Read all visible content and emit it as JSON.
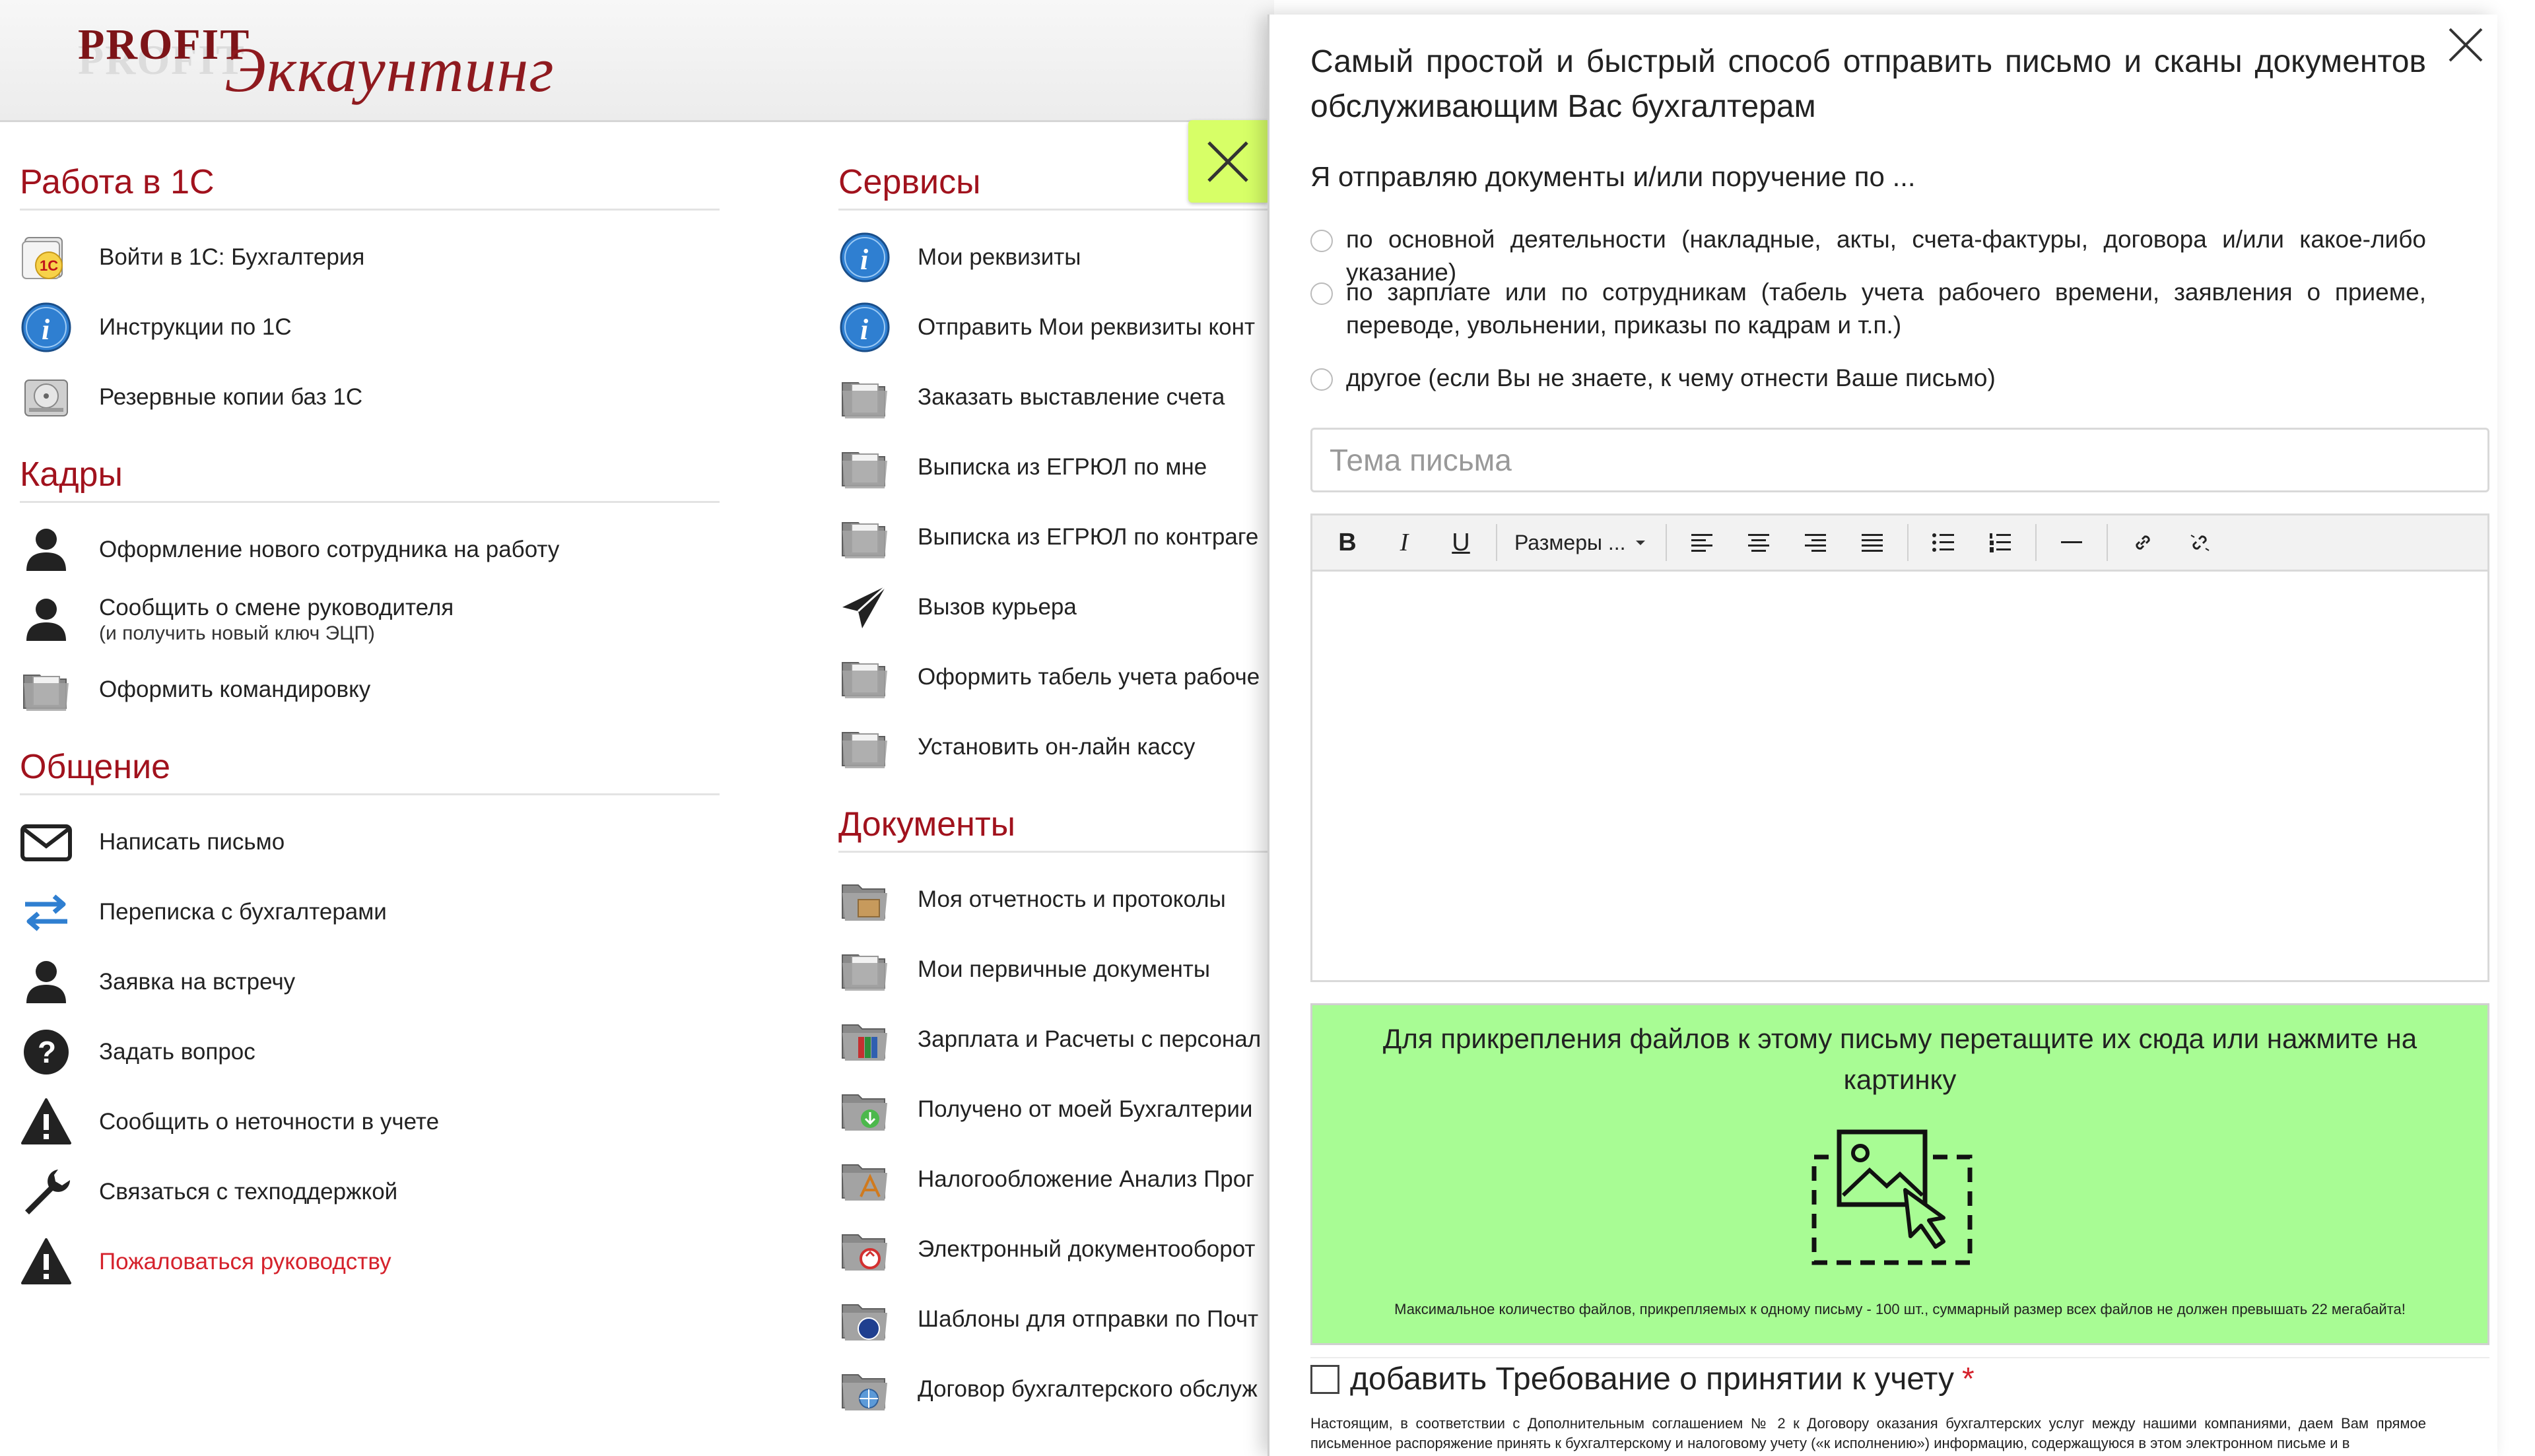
{
  "logo": {
    "brand": "PROFIT",
    "script": "Эккаунтинг"
  },
  "left_sections": [
    {
      "title": "Работа в 1С",
      "items": [
        {
          "label": "Войти в 1С: Бухгалтерия",
          "icon": "1c-icon"
        },
        {
          "label": "Инструкции по 1С",
          "icon": "info-icon"
        },
        {
          "label": "Резервные копии баз 1С",
          "icon": "hard-drive-icon"
        }
      ]
    },
    {
      "title": "Кадры",
      "items": [
        {
          "label": "Оформление нового сотрудника на работу",
          "icon": "person-icon"
        },
        {
          "label": "Сообщить о смене руководителя",
          "sub": "(и получить новый ключ ЭЦП)",
          "icon": "person-icon"
        },
        {
          "label": "Оформить командировку",
          "icon": "folder-icon"
        }
      ]
    },
    {
      "title": "Общение",
      "items": [
        {
          "label": "Написать письмо",
          "icon": "envelope-icon"
        },
        {
          "label": "Переписка с бухгалтерами",
          "icon": "exchange-arrows-icon"
        },
        {
          "label": "Заявка на встречу",
          "icon": "person-icon"
        },
        {
          "label": "Задать вопрос",
          "icon": "question-icon"
        },
        {
          "label": "Сообщить о неточности в учете",
          "icon": "warning-icon"
        },
        {
          "label": "Связаться с техподдержкой",
          "icon": "wrench-icon"
        },
        {
          "label": "Пожаловаться руководству",
          "icon": "warning-icon"
        }
      ]
    }
  ],
  "mid_sections": [
    {
      "title": "Сервисы",
      "items": [
        {
          "label": "Мои реквизиты",
          "icon": "info-icon"
        },
        {
          "label": "Отправить Мои реквизиты конт",
          "icon": "info-icon"
        },
        {
          "label": "Заказать выставление счета",
          "icon": "folder-icon"
        },
        {
          "label": "Выписка из ЕГРЮЛ по мне",
          "icon": "folder-icon"
        },
        {
          "label": "Выписка из ЕГРЮЛ по контраге",
          "icon": "folder-icon"
        },
        {
          "label": "Вызов курьера",
          "icon": "paper-plane-icon"
        },
        {
          "label": "Оформить табель учета рабоче",
          "icon": "folder-icon"
        },
        {
          "label": "Установить он-лайн кассу",
          "icon": "folder-icon"
        }
      ]
    },
    {
      "title": "Документы",
      "items": [
        {
          "label": "Моя отчетность и протоколы",
          "icon": "folder-box-icon"
        },
        {
          "label": "Мои первичные документы",
          "icon": "folder-icon"
        },
        {
          "label": "Зарплата и Расчеты с персонал",
          "icon": "folder-books-icon"
        },
        {
          "label": "Получено от моей Бухгалтерии",
          "icon": "folder-download-icon"
        },
        {
          "label": "Налогообложение Анализ Прог",
          "icon": "folder-app-icon"
        },
        {
          "label": "Электронный документооборот",
          "icon": "folder-sync-icon"
        },
        {
          "label": "Шаблоны для отправки по Почт",
          "icon": "folder-post-icon"
        },
        {
          "label": "Договор бухгалтерского обслуж",
          "icon": "folder-globe-icon"
        }
      ]
    }
  ],
  "panel": {
    "title": "Самый простой и быстрый способ отправить письмо и сканы документов обслуживающим Вас бухгалтерам",
    "subtitle": "Я отправляю документы и/или поручение по ...",
    "options": [
      "по основной деятельности (накладные, акты, счета-фактуры, договора и/или какое-либо указание)",
      "по зарплате или по сотрудникам (табель учета рабочего времени, заявления о приеме, переводе, увольнении, приказы по кадрам и т.п.)",
      "другое (если Вы не знаете, к чему отнести Ваше письмо)"
    ],
    "subject_placeholder": "Тема письма",
    "toolbar": {
      "bold": "B",
      "italic": "I",
      "underline": "U",
      "sizes": "Размеры ..."
    },
    "dropzone_text": "Для прикрепления файлов к этому письму перетащите их сюда или нажмите на картинку",
    "dropzone_limit": "Максимальное количество файлов, прикрепляемых к одному письму - 100 шт., суммарный размер всех файлов не должен превышать 22 мегабайта!",
    "accept_label": "добавить Требование о принятии к учету",
    "accept_star": "*",
    "accept_note": "Настоящим, в соответствии с Дополнительным соглашением № 2 к Договору оказания бухгалтерских услуг между нашими компаниями, даем Вам прямое письменное распоряжение принять к бухгалтерскому и налоговому учету («к исполнению») информацию, содержащуюся в этом электронном письме и в"
  },
  "colors": {
    "accent_red": "#a1121d",
    "close_tab": "#d7ff67",
    "dropzone": "#a8fc94",
    "info_blue": "#2f7fd1"
  }
}
